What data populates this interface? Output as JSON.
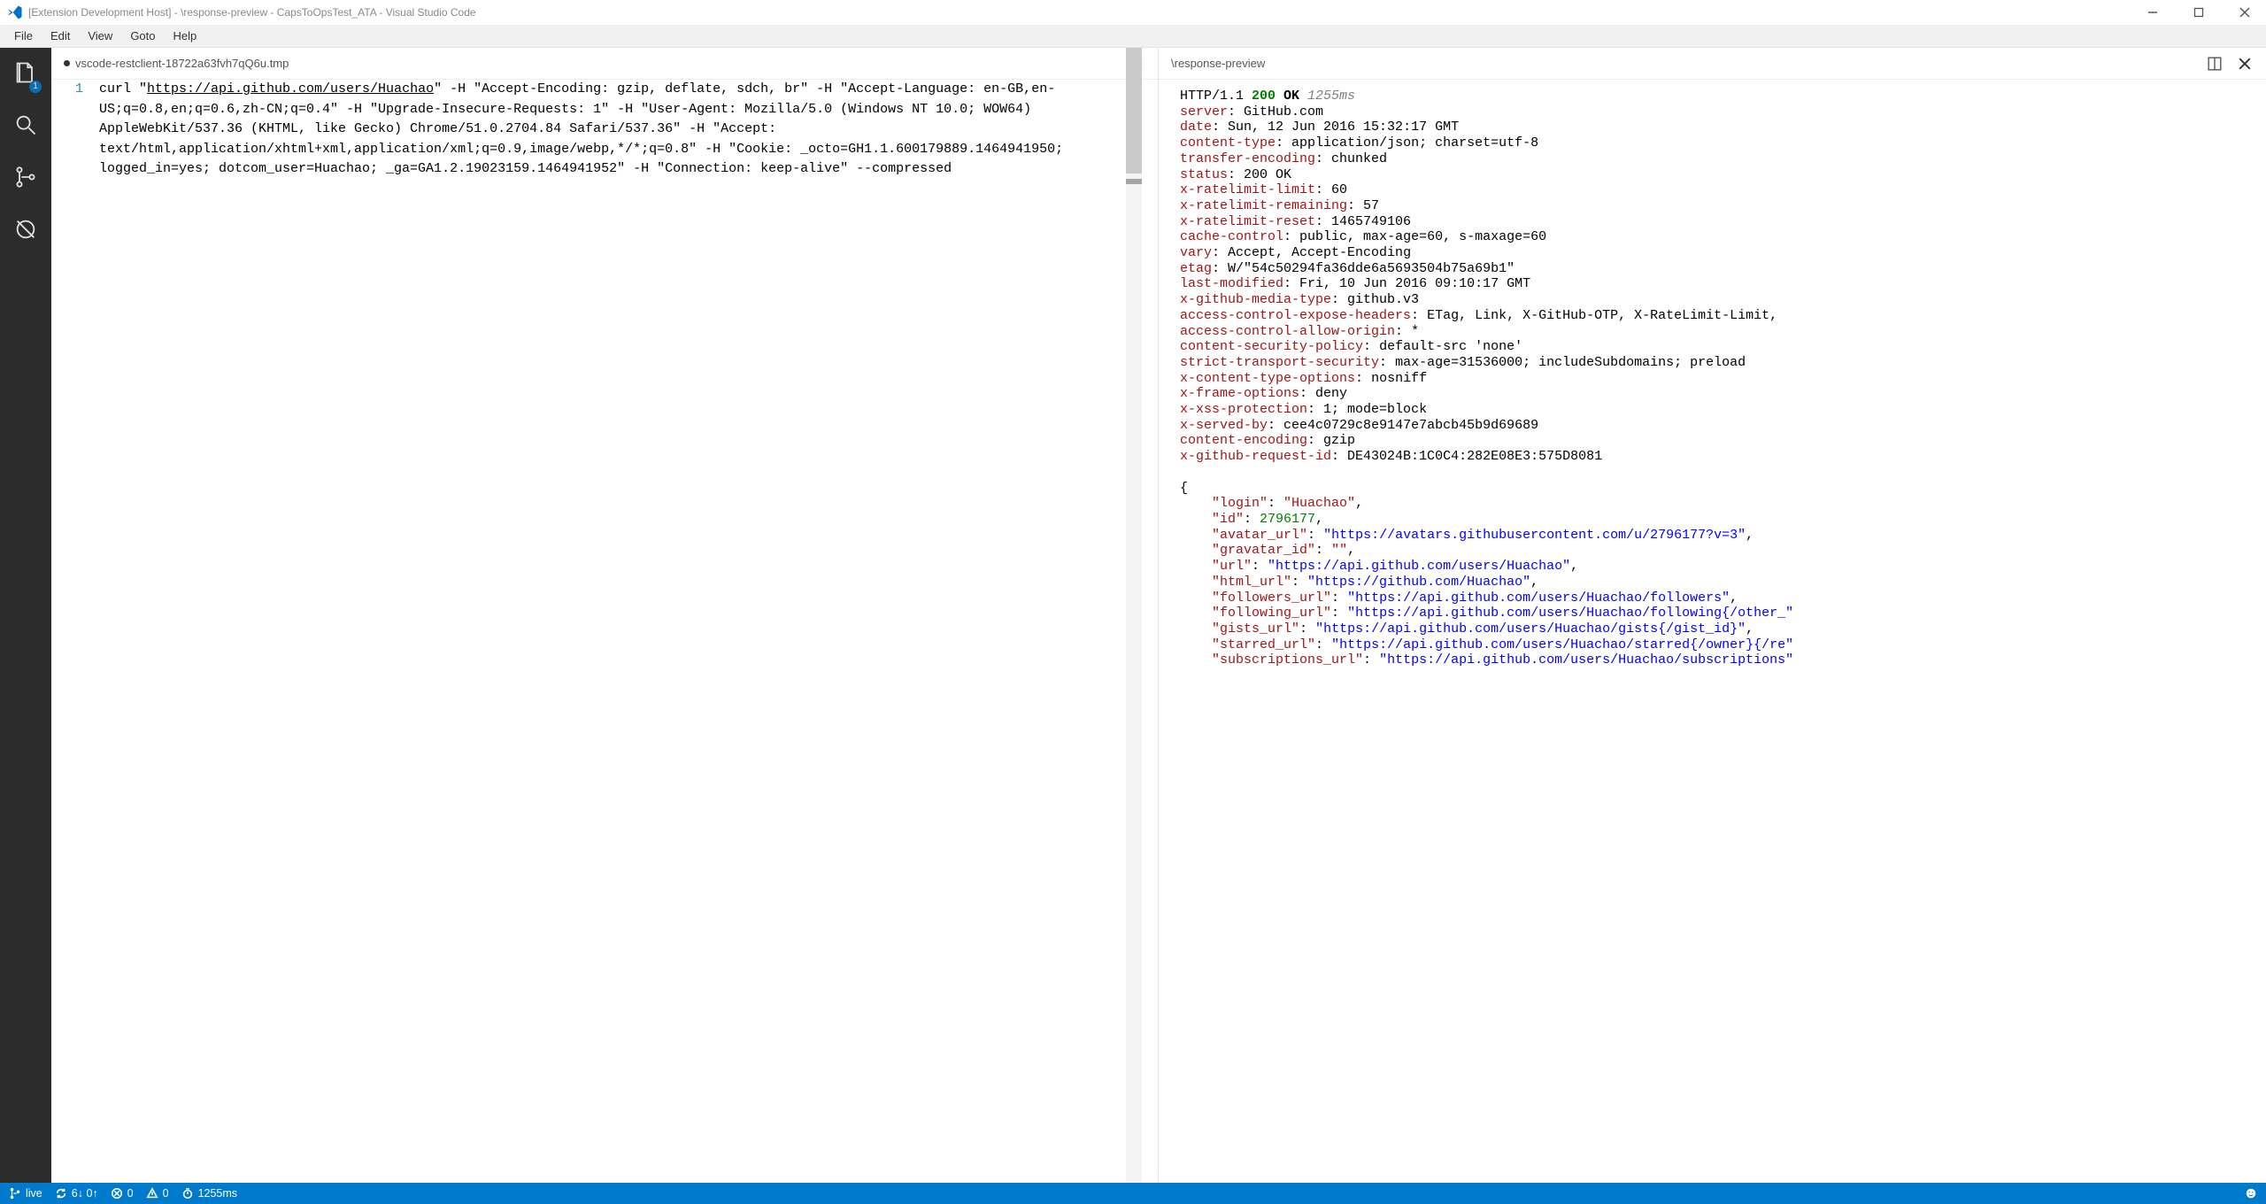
{
  "window": {
    "title": "[Extension Development Host] - \\response-preview - CapsToOpsTest_ATA - Visual Studio Code"
  },
  "menu": {
    "items": [
      "File",
      "Edit",
      "View",
      "Goto",
      "Help"
    ]
  },
  "activitybar": {
    "badge": "1"
  },
  "left_tab": {
    "title": "vscode-restclient-18722a63fvh7qQ6u.tmp",
    "line_number": "1",
    "code_prefix": "curl \"",
    "code_url": "https://api.github.com/users/Huachao",
    "code_suffix": "\" -H \"Accept-Encoding: gzip, deflate, sdch, br\" -H \"Accept-Language: en-GB,en-US;q=0.8,en;q=0.6,zh-CN;q=0.4\" -H \"Upgrade-Insecure-Requests: 1\" -H \"User-Agent: Mozilla/5.0 (Windows NT 10.0; WOW64) AppleWebKit/537.36 (KHTML, like Gecko) Chrome/51.0.2704.84 Safari/537.36\" -H \"Accept: text/html,application/xhtml+xml,application/xml;q=0.9,image/webp,*/*;q=0.8\" -H \"Cookie: _octo=GH1.1.600179889.1464941950; logged_in=yes; dotcom_user=Huachao; _ga=GA1.2.19023159.1464941952\" -H \"Connection: keep-alive\" --compressed"
  },
  "right_tab": {
    "title": "\\response-preview"
  },
  "response": {
    "proto": "HTTP/1.1 ",
    "code": "200",
    "ok": " OK ",
    "time": "1255ms",
    "headers": [
      {
        "k": "server",
        "v": "GitHub.com"
      },
      {
        "k": "date",
        "v": "Sun, 12 Jun 2016 15:32:17 GMT"
      },
      {
        "k": "content-type",
        "v": "application/json; charset=utf-8"
      },
      {
        "k": "transfer-encoding",
        "v": "chunked"
      },
      {
        "k": "status",
        "v": "200 OK"
      },
      {
        "k": "x-ratelimit-limit",
        "v": "60"
      },
      {
        "k": "x-ratelimit-remaining",
        "v": "57"
      },
      {
        "k": "x-ratelimit-reset",
        "v": "1465749106"
      },
      {
        "k": "cache-control",
        "v": "public, max-age=60, s-maxage=60"
      },
      {
        "k": "vary",
        "v": "Accept, Accept-Encoding"
      },
      {
        "k": "etag",
        "v": "W/\"54c50294fa36dde6a5693504b75a69b1\""
      },
      {
        "k": "last-modified",
        "v": "Fri, 10 Jun 2016 09:10:17 GMT"
      },
      {
        "k": "x-github-media-type",
        "v": "github.v3"
      },
      {
        "k": "access-control-expose-headers",
        "v": "ETag, Link, X-GitHub-OTP, X-RateLimit-Limit, "
      },
      {
        "k": "access-control-allow-origin",
        "v": "*"
      },
      {
        "k": "content-security-policy",
        "v": "default-src 'none'"
      },
      {
        "k": "strict-transport-security",
        "v": "max-age=31536000; includeSubdomains; preload"
      },
      {
        "k": "x-content-type-options",
        "v": "nosniff"
      },
      {
        "k": "x-frame-options",
        "v": "deny"
      },
      {
        "k": "x-xss-protection",
        "v": "1; mode=block"
      },
      {
        "k": "x-served-by",
        "v": "cee4c0729c8e9147e7abcb45b9d69689"
      },
      {
        "k": "content-encoding",
        "v": "gzip"
      },
      {
        "k": "x-github-request-id",
        "v": "DE43024B:1C0C4:282E08E3:575D8081"
      }
    ],
    "json": [
      {
        "indent": 0,
        "raw": "{"
      },
      {
        "indent": 1,
        "key": "login",
        "type": "s",
        "val": "Huachao",
        "trail": ","
      },
      {
        "indent": 1,
        "key": "id",
        "type": "n",
        "val": "2796177",
        "trail": ","
      },
      {
        "indent": 1,
        "key": "avatar_url",
        "type": "u",
        "val": "https://avatars.githubusercontent.com/u/2796177?v=3",
        "trail": ","
      },
      {
        "indent": 1,
        "key": "gravatar_id",
        "type": "s",
        "val": "",
        "trail": ","
      },
      {
        "indent": 1,
        "key": "url",
        "type": "u",
        "val": "https://api.github.com/users/Huachao",
        "trail": ","
      },
      {
        "indent": 1,
        "key": "html_url",
        "type": "u",
        "val": "https://github.com/Huachao",
        "trail": ","
      },
      {
        "indent": 1,
        "key": "followers_url",
        "type": "u",
        "val": "https://api.github.com/users/Huachao/followers",
        "trail": ","
      },
      {
        "indent": 1,
        "key": "following_url",
        "type": "u",
        "val": "https://api.github.com/users/Huachao/following{/other_",
        "trail": ""
      },
      {
        "indent": 1,
        "key": "gists_url",
        "type": "u",
        "val": "https://api.github.com/users/Huachao/gists{/gist_id}",
        "trail": ","
      },
      {
        "indent": 1,
        "key": "starred_url",
        "type": "u",
        "val": "https://api.github.com/users/Huachao/starred{/owner}{/re",
        "trail": ""
      },
      {
        "indent": 1,
        "key": "subscriptions_url",
        "type": "u",
        "val": "https://api.github.com/users/Huachao/subscriptions",
        "trail": ""
      }
    ]
  },
  "statusbar": {
    "branch": "live",
    "sync": "6↓ 0↑",
    "errors": "0",
    "warnings": "0",
    "timer": "1255ms"
  }
}
